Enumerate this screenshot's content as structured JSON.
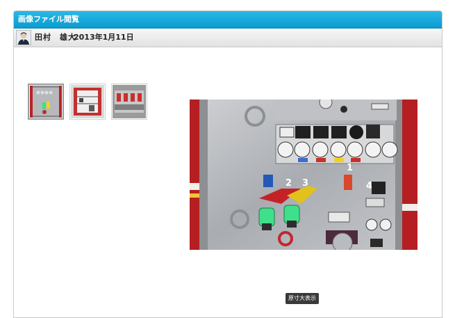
{
  "window": {
    "title": "画像ファイル閲覧"
  },
  "post": {
    "author": "田村　雄大",
    "date": "2013年1月11日"
  },
  "thumbnails": [
    {
      "name": "fire-engine-panel-closeup",
      "selected": true
    },
    {
      "name": "fire-engine-compartment",
      "selected": false
    },
    {
      "name": "fire-engine-side-panel",
      "selected": false
    }
  ],
  "main_image": {
    "name": "fire-engine-pump-panel"
  },
  "controls": {
    "full_size_label": "原寸大表示"
  },
  "panel_labels": [
    "1",
    "2",
    "3",
    "4"
  ],
  "colors": {
    "title_bar": "#0a9ccf",
    "button": "#3a3a3a",
    "valve_green": "#3fe08a",
    "valve_yellow": "#f2d21b"
  }
}
